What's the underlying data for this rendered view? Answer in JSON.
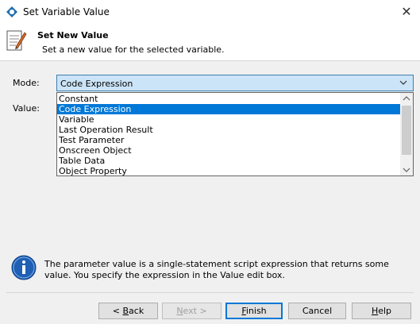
{
  "window": {
    "title": "Set Variable Value",
    "close_label": "✕"
  },
  "header": {
    "title": "Set New Value",
    "subtitle": "Set a new value for the selected variable."
  },
  "form": {
    "mode_label": "Mode:",
    "value_label": "Value:",
    "mode_selected": "Code Expression",
    "mode_options": [
      "Constant",
      "Code Expression",
      "Variable",
      "Last Operation Result",
      "Test Parameter",
      "Onscreen Object",
      "Table Data",
      "Object Property"
    ]
  },
  "info": {
    "text": "The parameter value is a single-statement script expression that returns some value. You specify the expression in the Value edit box."
  },
  "buttons": {
    "back": {
      "pre": "< ",
      "accel": "B",
      "post": "ack"
    },
    "next": {
      "accel": "N",
      "post": "ext >"
    },
    "finish": {
      "accel": "F",
      "post": "inish"
    },
    "cancel": {
      "label": "Cancel"
    },
    "help": {
      "accel": "H",
      "post": "elp"
    }
  }
}
